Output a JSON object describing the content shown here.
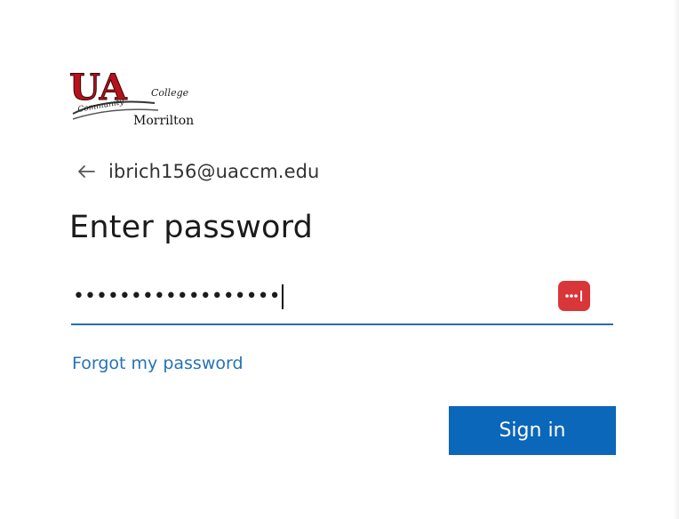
{
  "logo": {
    "main_text": "UA",
    "arc_text": "Community",
    "college_text": "College",
    "location_text": "Morrilton"
  },
  "identity": {
    "email": "ibrich156@uaccm.edu"
  },
  "heading": "Enter password",
  "password": {
    "masked_value": "••••••••••••••••••",
    "manager_icon": "password-manager-icon"
  },
  "forgot_link": "Forgot my password",
  "signin_button": "Sign in",
  "colors": {
    "accent": "#0b67b9",
    "link": "#2672b6",
    "underline": "#2b6ea6",
    "logo_red": "#b5121b",
    "manager_red": "#d9363a"
  }
}
